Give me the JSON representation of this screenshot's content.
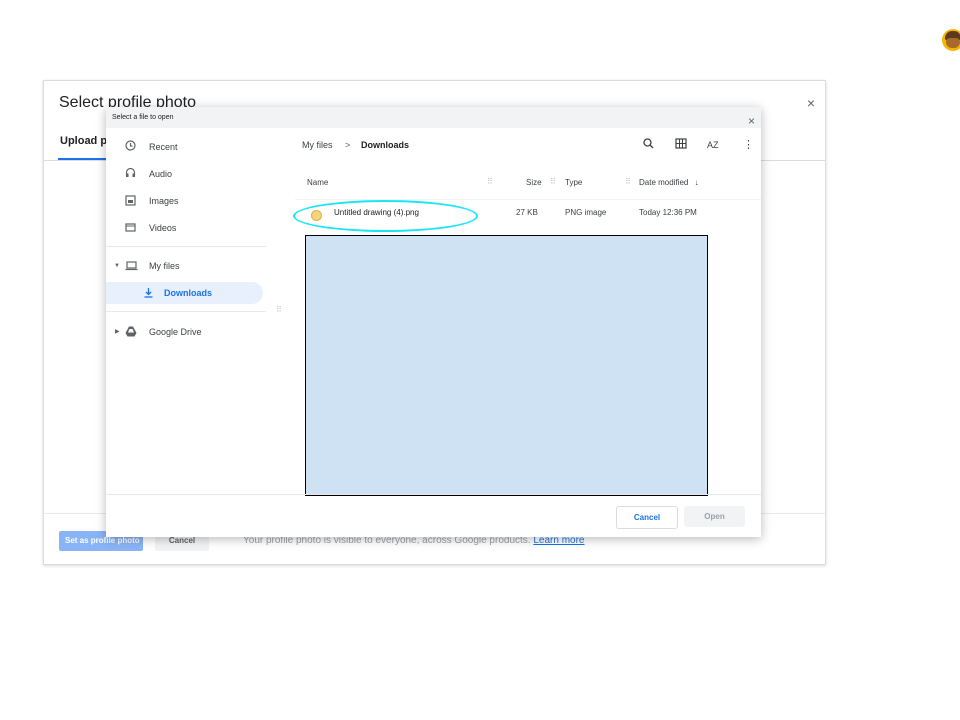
{
  "background_dialog": {
    "title": "Select profile photo",
    "close_icon": "×",
    "tab_label": "Upload ph",
    "set_button": "Set as profile photo",
    "cancel_button": "Cancel",
    "note": "Your profile photo is visible to everyone, across Google products.",
    "learn_more": "Learn more"
  },
  "picker": {
    "title": "Select a file to open",
    "close_icon": "×",
    "nav": {
      "recent": "Recent",
      "audio": "Audio",
      "images": "Images",
      "videos": "Videos",
      "my_files": "My files",
      "downloads": "Downloads",
      "google_drive": "Google Drive"
    },
    "breadcrumb": {
      "root": "My files",
      "separator": ">",
      "current": "Downloads"
    },
    "toolbar": {
      "search": "⚲",
      "grid": "⊞",
      "sort": "AZ",
      "more": "⋮"
    },
    "columns": {
      "name": "Name",
      "size": "Size",
      "type": "Type",
      "date": "Date modified",
      "sort_arrow": "↓"
    },
    "file": {
      "name": "Untitled drawing (4).png",
      "size": "27 KB",
      "type": "PNG image",
      "date": "Today 12:36 PM"
    },
    "cancel_button": "Cancel",
    "open_button": "Open"
  },
  "colors": {
    "accent": "#1a73e8",
    "highlight_ring": "#19e6f5",
    "redaction": "#cfe2f3",
    "nav_selected": "#e8f0fe"
  }
}
